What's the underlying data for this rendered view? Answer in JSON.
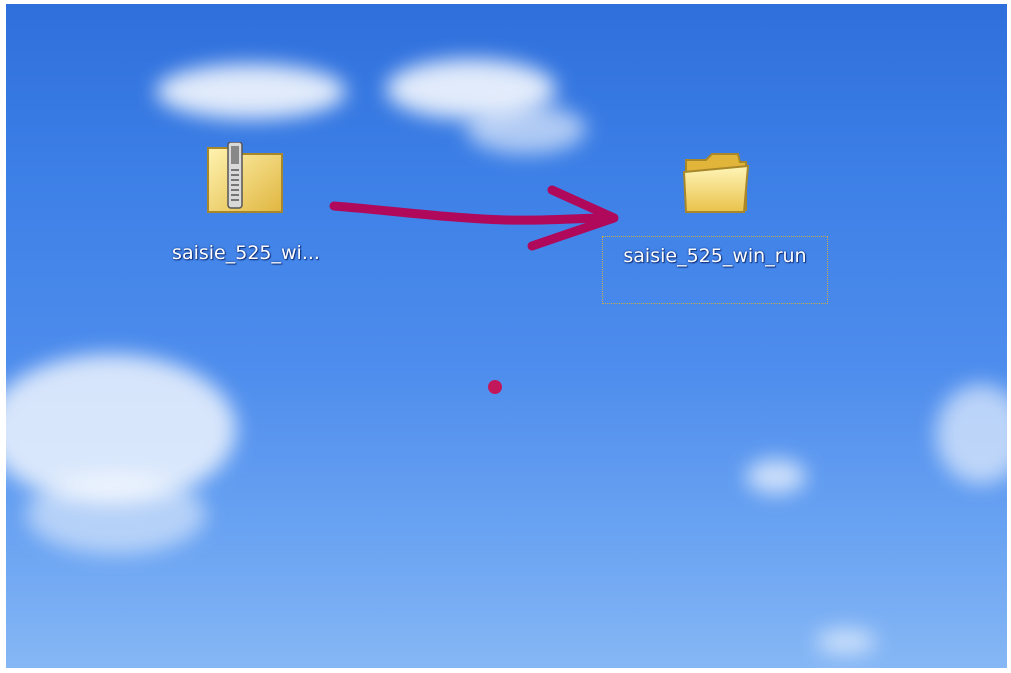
{
  "desktop": {
    "icons": [
      {
        "label": "saisie_525_wi...",
        "icon": "zip-folder-icon",
        "selected": false
      },
      {
        "label": "saisie_525_win_run",
        "icon": "folder-icon",
        "selected": true
      }
    ],
    "annotation": {
      "arrow_color": "#b0085a",
      "dot_color": "#c2185b"
    }
  }
}
